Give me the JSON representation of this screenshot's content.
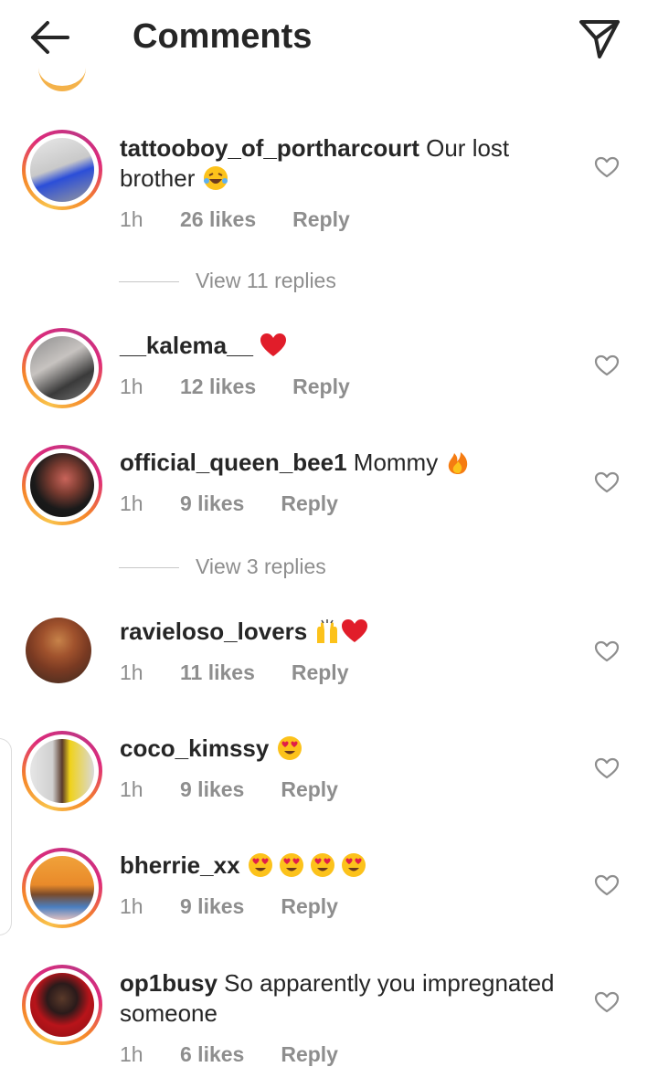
{
  "header": {
    "title": "Comments"
  },
  "comments": [
    {
      "username": "tattooboy_of_portharcourt",
      "text": "Our lost brother",
      "emojis": [
        "laughing"
      ],
      "time": "1h",
      "likes": "26 likes",
      "reply": "Reply",
      "story_ring": true,
      "avatar_colors": [
        "#c9c9c9",
        "#2b4ed8"
      ]
    },
    {
      "username": "__kalema__",
      "text": "",
      "emojis": [
        "heart"
      ],
      "time": "1h",
      "likes": "12 likes",
      "reply": "Reply",
      "story_ring": true,
      "avatar_colors": [
        "#aaa6a6",
        "#3a3a3a"
      ]
    },
    {
      "username": "official_queen_bee1",
      "text": "Mommy",
      "emojis": [
        "fire"
      ],
      "time": "1h",
      "likes": "9 likes",
      "reply": "Reply",
      "story_ring": true,
      "avatar_colors": [
        "#1a1a1a",
        "#c9645a"
      ]
    },
    {
      "username": "ravieloso_lovers",
      "text": "",
      "emojis": [
        "raised-hands",
        "heart"
      ],
      "time": "1h",
      "likes": "11 likes",
      "reply": "Reply",
      "story_ring": false,
      "avatar_colors": [
        "#7a3a22",
        "#c7834a"
      ]
    },
    {
      "username": "coco_kimssy",
      "text": "",
      "emojis": [
        "heart-eyes"
      ],
      "time": "1h",
      "likes": "9 likes",
      "reply": "Reply",
      "story_ring": true,
      "avatar_colors": [
        "#d9d9d9",
        "#f0d21a"
      ]
    },
    {
      "username": "bherrie_xx",
      "text": "",
      "emojis": [
        "heart-eyes",
        "heart-eyes",
        "heart-eyes",
        "heart-eyes"
      ],
      "time": "1h",
      "likes": "9 likes",
      "reply": "Reply",
      "story_ring": true,
      "avatar_colors": [
        "#e98a2a",
        "#4a7fc1"
      ]
    },
    {
      "username": "op1busy",
      "text": "So apparently you impregnated someone",
      "emojis": [],
      "time": "1h",
      "likes": "6 likes",
      "reply": "Reply",
      "story_ring": true,
      "avatar_colors": [
        "#b8141a",
        "#2a1a1a"
      ]
    }
  ],
  "view_replies": [
    "View 11 replies",
    "View 3 replies"
  ],
  "colors": {
    "text": "#262626",
    "secondary": "#8e8e8e",
    "ring_start": "#f9c34b",
    "ring_end": "#c13584"
  }
}
